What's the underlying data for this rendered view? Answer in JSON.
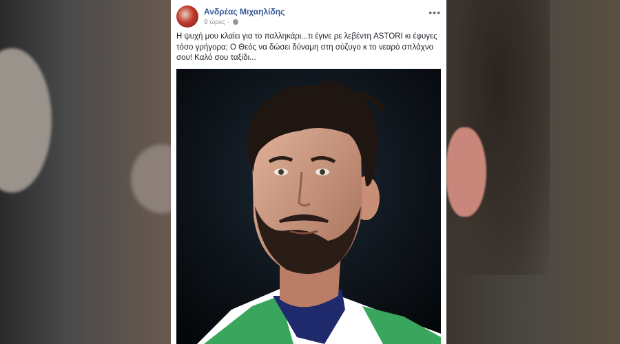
{
  "post": {
    "author": "Ανδρέας Μιχαηλίδης",
    "timestamp": "9 ώρες",
    "separator": "·",
    "text": "Η ψυχή μου κλαίει για το παλληκάρι...τι έγινε ρε λεβέντη ASTORI κι έφυγες τόσο γρήγορα; Ο Θεός να δώσει δύναμη στη σύζυγο κ το νεαρό σπλάχνο σου! Καλό σου ταξίδι...",
    "more_glyph": "•••"
  },
  "icons": {
    "avatar": "profile-avatar",
    "privacy": "globe-icon",
    "menu": "more-options-icon"
  },
  "colors": {
    "author_link": "#365899",
    "meta_text": "#90949c",
    "body_text": "#1d2129"
  }
}
